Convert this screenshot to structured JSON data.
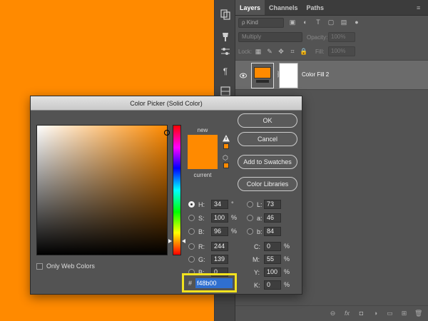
{
  "colors": {
    "accent": "#ff8a00",
    "highlight": "#f2e21e"
  },
  "layers_panel": {
    "tabs": [
      "Layers",
      "Channels",
      "Paths"
    ],
    "menu_icon": "panel-menu-icon",
    "kind_label": "ρ Kind",
    "blend_mode": "Multiply",
    "opacity_label": "Opacity:",
    "opacity_value": "100%",
    "lock_label": "Lock:",
    "fill_label": "Fill:",
    "fill_value": "100%",
    "layer": {
      "name": "Color Fill 2"
    }
  },
  "dialog": {
    "title": "Color Picker (Solid Color)",
    "new_label": "new",
    "current_label": "current",
    "buttons": {
      "ok": "OK",
      "cancel": "Cancel",
      "add_to_swatches": "Add to Swatches",
      "color_libraries": "Color Libraries"
    },
    "hsb": [
      {
        "label": "H:",
        "value": "34",
        "unit": "°",
        "selected": true
      },
      {
        "label": "S:",
        "value": "100",
        "unit": "%",
        "selected": false
      },
      {
        "label": "B:",
        "value": "96",
        "unit": "%",
        "selected": false
      }
    ],
    "rgb": [
      {
        "label": "R:",
        "value": "244"
      },
      {
        "label": "G:",
        "value": "139"
      },
      {
        "label": "B:",
        "value": "0"
      }
    ],
    "lab": [
      {
        "label": "L:",
        "value": "73"
      },
      {
        "label": "a:",
        "value": "46"
      },
      {
        "label": "b:",
        "value": "84"
      }
    ],
    "cmyk": [
      {
        "label": "C:",
        "value": "0",
        "unit": "%"
      },
      {
        "label": "M:",
        "value": "55",
        "unit": "%"
      },
      {
        "label": "Y:",
        "value": "100",
        "unit": "%"
      },
      {
        "label": "K:",
        "value": "0",
        "unit": "%"
      }
    ],
    "only_web_colors": "Only Web Colors",
    "hex_hash": "#",
    "hex_value": "f48b00"
  }
}
